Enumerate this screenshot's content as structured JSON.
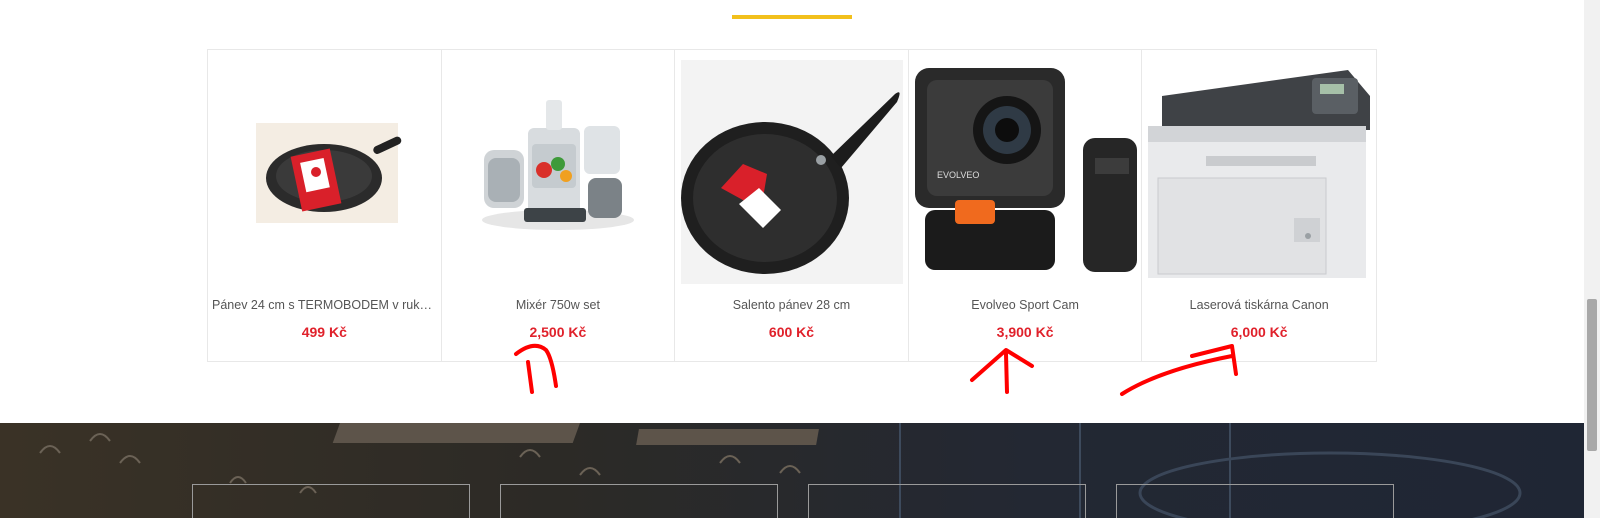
{
  "products": [
    {
      "name": "Pánev 24 cm s TERMOBODEM v ruko...",
      "price": "499 Kč",
      "image": "frying-pan-package"
    },
    {
      "name": "Mixér 750w set",
      "price": "2,500 Kč",
      "image": "food-processor"
    },
    {
      "name": "Salento pánev 28 cm",
      "price": "600 Kč",
      "image": "frying-pan"
    },
    {
      "name": "Evolveo Sport Cam",
      "price": "3,900 Kč",
      "image": "action-camera"
    },
    {
      "name": "Laserová tiskárna Canon",
      "price": "6,000 Kč",
      "image": "laser-printer"
    }
  ],
  "brand_label": "EVOLVEO",
  "colors": {
    "accent": "#f2c01c",
    "price": "#e0212b",
    "annotation": "#ff0000"
  }
}
